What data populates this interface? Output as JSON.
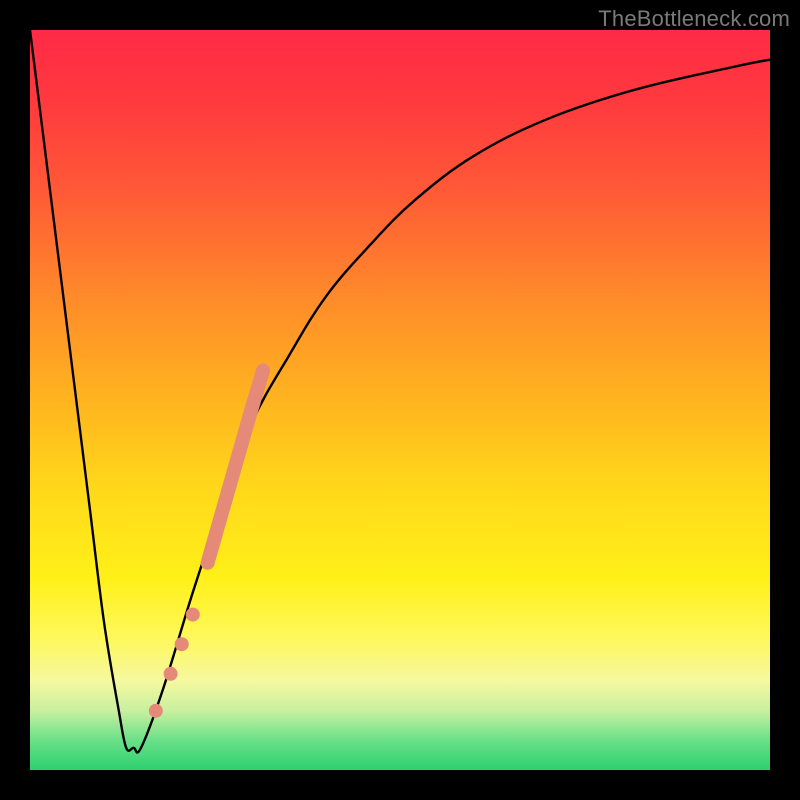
{
  "watermark": "TheBottleneck.com",
  "chart_data": {
    "type": "line",
    "title": "",
    "xlabel": "",
    "ylabel": "",
    "ylim": [
      0,
      100
    ],
    "xlim": [
      0,
      100
    ],
    "series": [
      {
        "name": "curve",
        "x": [
          0,
          2,
          5,
          8,
          10,
          12,
          13,
          14,
          15,
          18,
          22,
          26,
          30,
          35,
          40,
          46,
          52,
          60,
          70,
          82,
          95,
          100
        ],
        "values": [
          100,
          84,
          60,
          36,
          20,
          8,
          3,
          3,
          3,
          11,
          24,
          36,
          47,
          56,
          64,
          71,
          77,
          83,
          88,
          92,
          95,
          96
        ]
      },
      {
        "name": "markers",
        "x": [
          17,
          19,
          20.5,
          22,
          24,
          26,
          28,
          30,
          31.5
        ],
        "values": [
          8,
          13,
          17,
          21,
          28,
          35,
          42,
          49,
          54
        ]
      }
    ],
    "marker_band": {
      "start_index": 4,
      "end_index": 8
    },
    "colors": {
      "curve": "#000000",
      "marker_fill": "#e58a78",
      "marker_stroke": "#d07060"
    }
  }
}
